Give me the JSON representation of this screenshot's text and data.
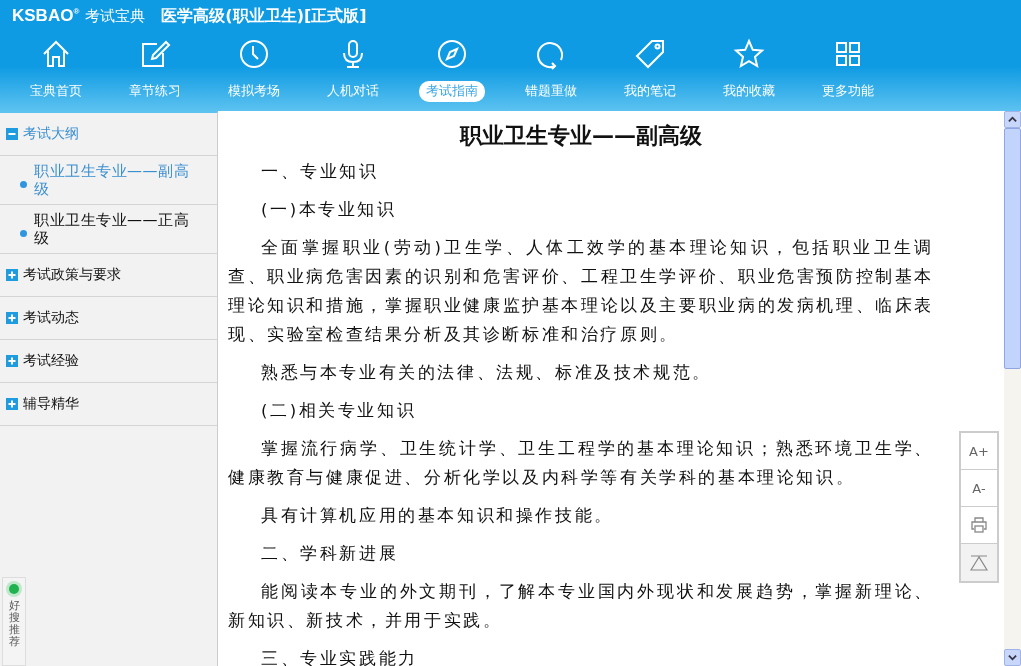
{
  "header": {
    "brand": "KSBAO",
    "brand_mark": "®",
    "brand_cn": "考试宝典",
    "title": "医学高级(职业卫生)[正式版]"
  },
  "nav": [
    {
      "label": "宝典首页",
      "selected": false
    },
    {
      "label": "章节练习",
      "selected": false
    },
    {
      "label": "模拟考场",
      "selected": false
    },
    {
      "label": "人机对话",
      "selected": false
    },
    {
      "label": "考试指南",
      "selected": true
    },
    {
      "label": "错题重做",
      "selected": false
    },
    {
      "label": "我的笔记",
      "selected": false
    },
    {
      "label": "我的收藏",
      "selected": false
    },
    {
      "label": "更多功能",
      "selected": false
    }
  ],
  "sidebar": {
    "sections": [
      {
        "label": "考试大纲",
        "expanded": true,
        "children": [
          {
            "label": "职业卫生专业——副高级",
            "selected": true
          },
          {
            "label": "职业卫生专业——正高级",
            "selected": false
          }
        ]
      },
      {
        "label": "考试政策与要求",
        "expanded": false
      },
      {
        "label": "考试动态",
        "expanded": false
      },
      {
        "label": "考试经验",
        "expanded": false
      },
      {
        "label": "辅导精华",
        "expanded": false
      }
    ]
  },
  "article": {
    "title": "职业卫生专业——副高级",
    "paragraphs": [
      "一、专业知识",
      "(一)本专业知识",
      "全面掌握职业(劳动)卫生学、人体工效学的基本理论知识，包括职业卫生调查、职业病危害因素的识别和危害评价、工程卫生学评价、职业危害预防控制基本理论知识和措施，掌握职业健康监护基本理论以及主要职业病的发病机理、临床表现、实验室检查结果分析及其诊断标准和治疗原则。",
      "熟悉与本专业有关的法律、法规、标准及技术规范。",
      "(二)相关专业知识",
      "掌握流行病学、卫生统计学、卫生工程学的基本理论知识；熟悉环境卫生学、健康教育与健康促进、分析化学以及内科学等有关学科的基本理论知识。",
      "具有计算机应用的基本知识和操作技能。",
      "二、学科新进展",
      "能阅读本专业的外文期刊，了解本专业国内外现状和发展趋势，掌握新理论、新知识、新技术，并用于实践。",
      "三、专业实践能力"
    ]
  },
  "tools": [
    {
      "kind": "text",
      "label": "A+"
    },
    {
      "kind": "text",
      "label": "A-"
    },
    {
      "kind": "print"
    },
    {
      "kind": "top"
    }
  ],
  "widget": {
    "label": "好搜推荐"
  }
}
